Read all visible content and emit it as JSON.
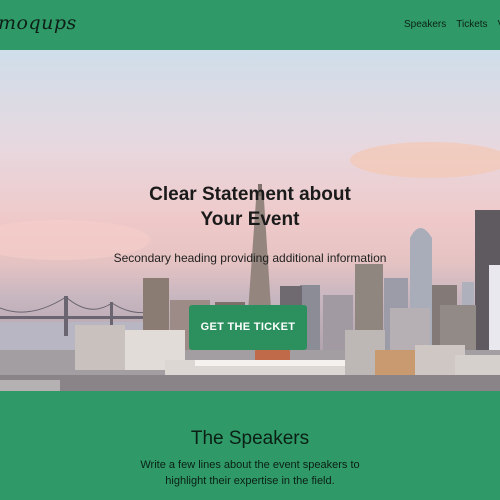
{
  "header": {
    "logo": "moqups",
    "nav": [
      "Speakers",
      "Tickets",
      "Ve"
    ]
  },
  "hero": {
    "title_line1": "Clear Statement about",
    "title_line2": "Your Event",
    "subtitle": "Secondary heading providing additional information",
    "cta_label": "GET THE TICKET"
  },
  "speakers": {
    "title": "The Speakers",
    "description": "Write a few lines about the event speakers to highlight their expertise in the field."
  },
  "colors": {
    "brand_green": "#2f9a68",
    "cta_green": "#2c8f5e"
  }
}
